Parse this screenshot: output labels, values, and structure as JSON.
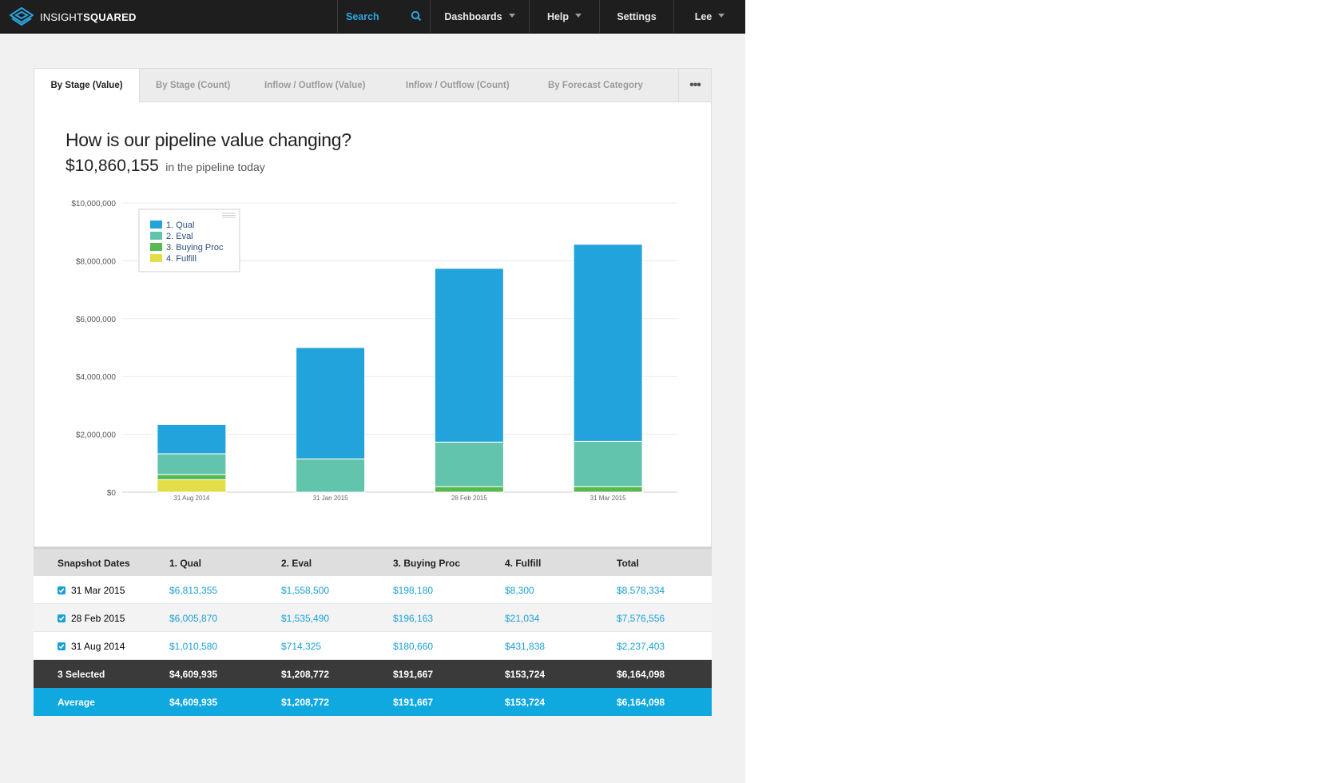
{
  "nav": {
    "brand_light": "INSIGHT",
    "brand_bold": "SQUARED",
    "search_label": "Search",
    "dashboards_label": "Dashboards",
    "help_label": "Help",
    "settings_label": "Settings",
    "user_label": "Lee"
  },
  "tabs": [
    {
      "label": "By Stage (Value)",
      "active": true
    },
    {
      "label": "By Stage (Count)",
      "active": false
    },
    {
      "label": "Inflow / Outflow (Value)",
      "active": false
    },
    {
      "label": "Inflow / Outflow (Count)",
      "active": false
    },
    {
      "label": "By Forecast Category",
      "active": false
    }
  ],
  "tab_more_label": "•••",
  "header": {
    "question": "How is our pipeline value changing?",
    "pipeline_total": "$10,860,155",
    "pipeline_suffix": "in the pipeline today"
  },
  "chart_data": {
    "type": "bar",
    "stacked": true,
    "categories": [
      "31 Aug 2014",
      "31 Jan 2015",
      "28 Feb 2015",
      "31 Mar 2015"
    ],
    "series": [
      {
        "name": "4. Fulfill",
        "color": "#e3dd47",
        "values": [
          431838,
          0,
          0,
          0
        ]
      },
      {
        "name": "3. Buying Proc",
        "color": "#57b94f",
        "values": [
          180660,
          0,
          196163,
          198180
        ]
      },
      {
        "name": "2. Eval",
        "color": "#62c4ad",
        "values": [
          714325,
          1150000,
          1535490,
          1558500
        ]
      },
      {
        "name": "1. Qual",
        "color": "#22a3dc",
        "values": [
          1010580,
          3850000,
          6005870,
          6813355
        ]
      }
    ],
    "legend_order": [
      "1. Qual",
      "2. Eval",
      "3. Buying Proc",
      "4. Fulfill"
    ],
    "yticks": [
      "$0",
      "$2,000,000",
      "$4,000,000",
      "$6,000,000",
      "$8,000,000",
      "$10,000,000"
    ],
    "ylim": [
      0,
      10000000
    ],
    "grid": true,
    "legend_position": "top-left"
  },
  "table": {
    "headers": [
      "Snapshot Dates",
      "1. Qual",
      "2. Eval",
      "3. Buying Proc",
      "4. Fulfill",
      "Total"
    ],
    "rows": [
      [
        "31 Mar 2015",
        "$6,813,355",
        "$1,558,500",
        "$198,180",
        "$8,300",
        "$8,578,334"
      ],
      [
        "28 Feb 2015",
        "$6,005,870",
        "$1,535,490",
        "$196,163",
        "$21,034",
        "$7,576,556"
      ],
      [
        "31 Aug 2014",
        "$1,010,580",
        "$714,325",
        "$180,660",
        "$431,838",
        "$2,237,403"
      ]
    ],
    "selected": [
      "3 Selected",
      "$4,609,935",
      "$1,208,772",
      "$191,667",
      "$153,724",
      "$6,164,098"
    ],
    "average": [
      "Average",
      "$4,609,935",
      "$1,208,772",
      "$191,667",
      "$153,724",
      "$6,164,098"
    ]
  }
}
